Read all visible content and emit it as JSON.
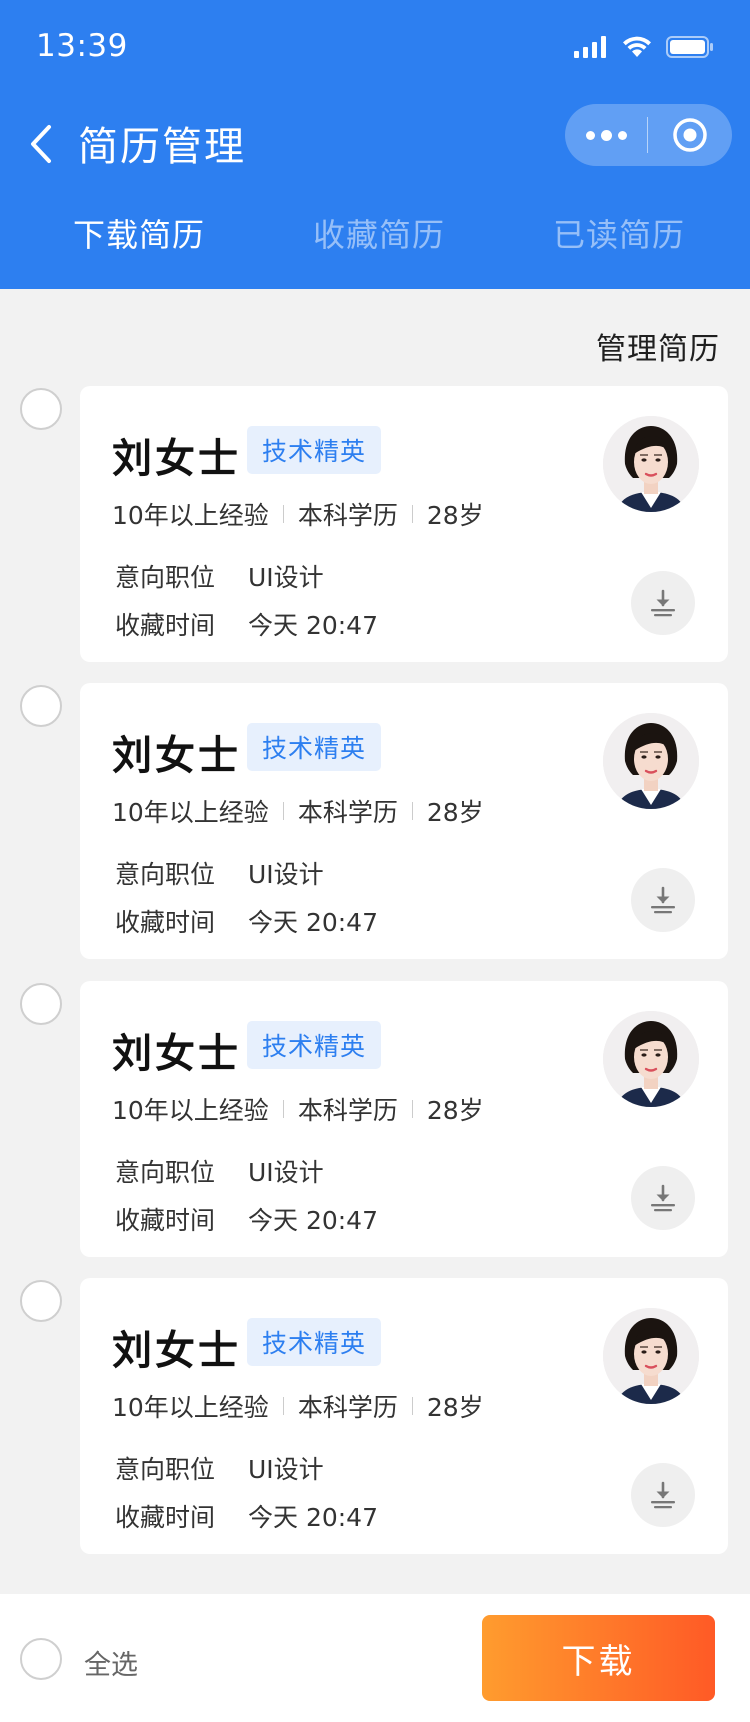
{
  "status_bar": {
    "time": "13:39"
  },
  "nav": {
    "title": "简历管理"
  },
  "tabs": [
    {
      "label": "下载简历",
      "active": true
    },
    {
      "label": "收藏简历",
      "active": false
    },
    {
      "label": "已读简历",
      "active": false
    }
  ],
  "manage_label": "管理简历",
  "resumes": [
    {
      "name": "刘女士",
      "tag": "技术精英",
      "experience": "10年以上经验",
      "education": "本科学历",
      "age": "28岁",
      "position_label": "意向职位",
      "position": "UI设计",
      "time_label": "收藏时间",
      "time": "今天 20:47"
    },
    {
      "name": "刘女士",
      "tag": "技术精英",
      "experience": "10年以上经验",
      "education": "本科学历",
      "age": "28岁",
      "position_label": "意向职位",
      "position": "UI设计",
      "time_label": "收藏时间",
      "time": "今天 20:47"
    },
    {
      "name": "刘女士",
      "tag": "技术精英",
      "experience": "10年以上经验",
      "education": "本科学历",
      "age": "28岁",
      "position_label": "意向职位",
      "position": "UI设计",
      "time_label": "收藏时间",
      "time": "今天 20:47"
    },
    {
      "name": "刘女士",
      "tag": "技术精英",
      "experience": "10年以上经验",
      "education": "本科学历",
      "age": "28岁",
      "position_label": "意向职位",
      "position": "UI设计",
      "time_label": "收藏时间",
      "time": "今天 20:47"
    }
  ],
  "bottom": {
    "select_all": "全选",
    "download": "下载"
  },
  "icons": {
    "back": "chevron-left-icon",
    "more": "more-dots-icon",
    "close": "capsule-close-icon",
    "download": "download-icon",
    "avatar": "avatar-photo"
  },
  "colors": {
    "primary": "#2d7ff0",
    "tag_bg": "#e7f0fd",
    "accent_start": "#ff9c2e",
    "accent_end": "#ff5a26"
  }
}
